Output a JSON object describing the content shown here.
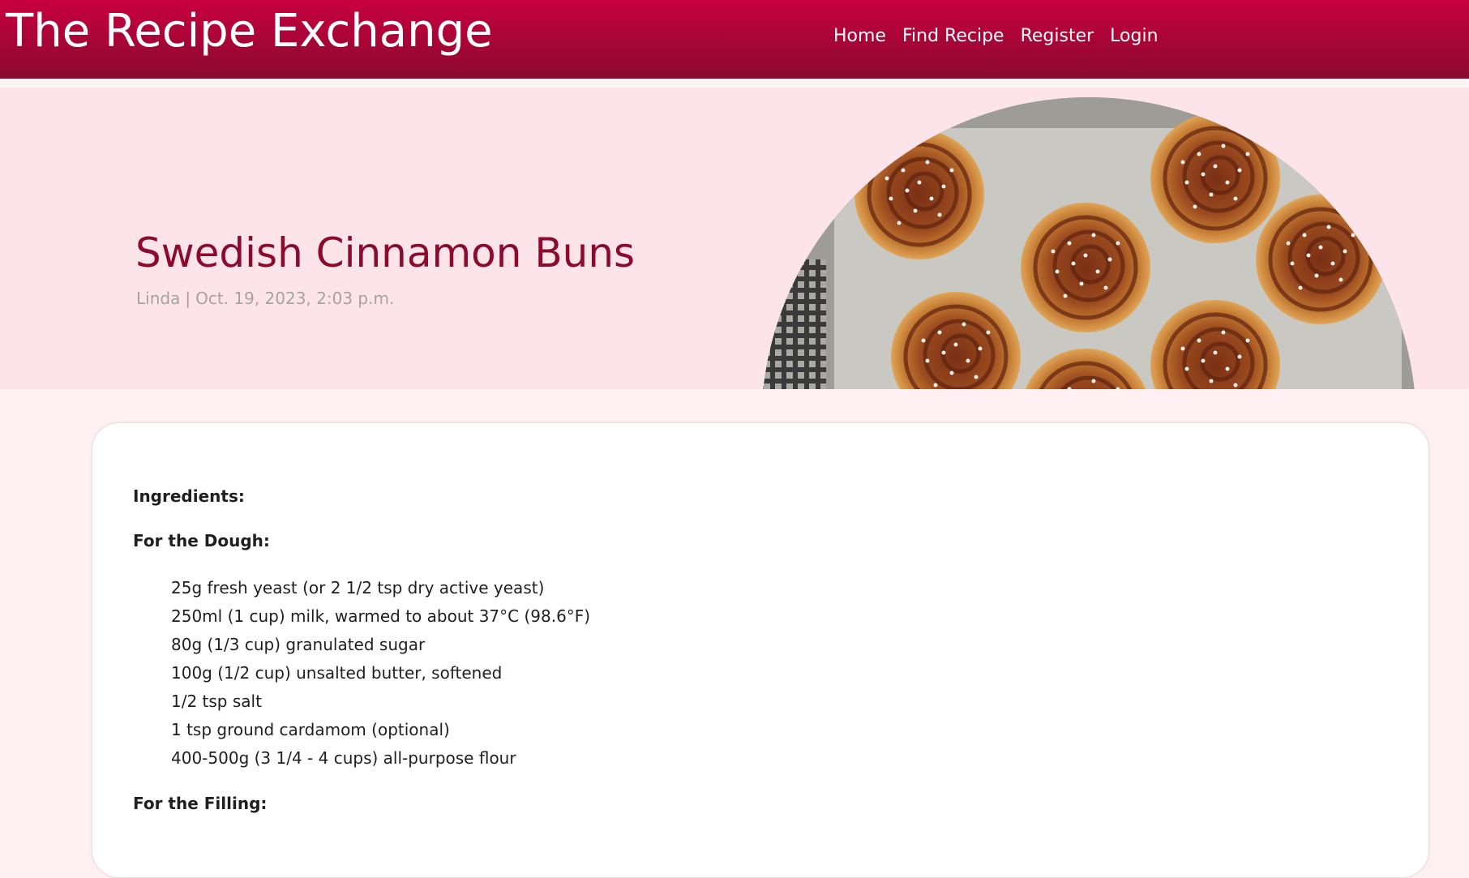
{
  "header": {
    "brand": "The Recipe Exchange",
    "nav": [
      {
        "label": "Home"
      },
      {
        "label": "Find Recipe"
      },
      {
        "label": "Register"
      },
      {
        "label": "Login"
      }
    ]
  },
  "post": {
    "title": "Swedish Cinnamon Buns",
    "author": "Linda",
    "separator": "|",
    "date": "Oct. 19, 2023, 2:03 p.m.",
    "image_icon": "cinnamon-buns-photo"
  },
  "recipe": {
    "ingredients_heading": "Ingredients:",
    "dough_heading": "For the Dough:",
    "dough_items": [
      "25g fresh yeast (or 2 1/2 tsp dry active yeast)",
      "250ml (1 cup) milk, warmed to about 37°C (98.6°F)",
      "80g (1/3 cup) granulated sugar",
      "100g (1/2 cup) unsalted butter, softened",
      "1/2 tsp salt",
      "1 tsp ground cardamom (optional)",
      "400-500g (3 1/4 - 4 cups) all-purpose flour"
    ],
    "filling_heading": "For the Filling:"
  },
  "colors": {
    "header_top": "#c8003f",
    "header_bottom": "#8a0a30",
    "masthead_bg": "#fde4ea",
    "title": "#8b0a2e",
    "meta": "#a6a2a4",
    "page_bg": "#fff0f4"
  }
}
